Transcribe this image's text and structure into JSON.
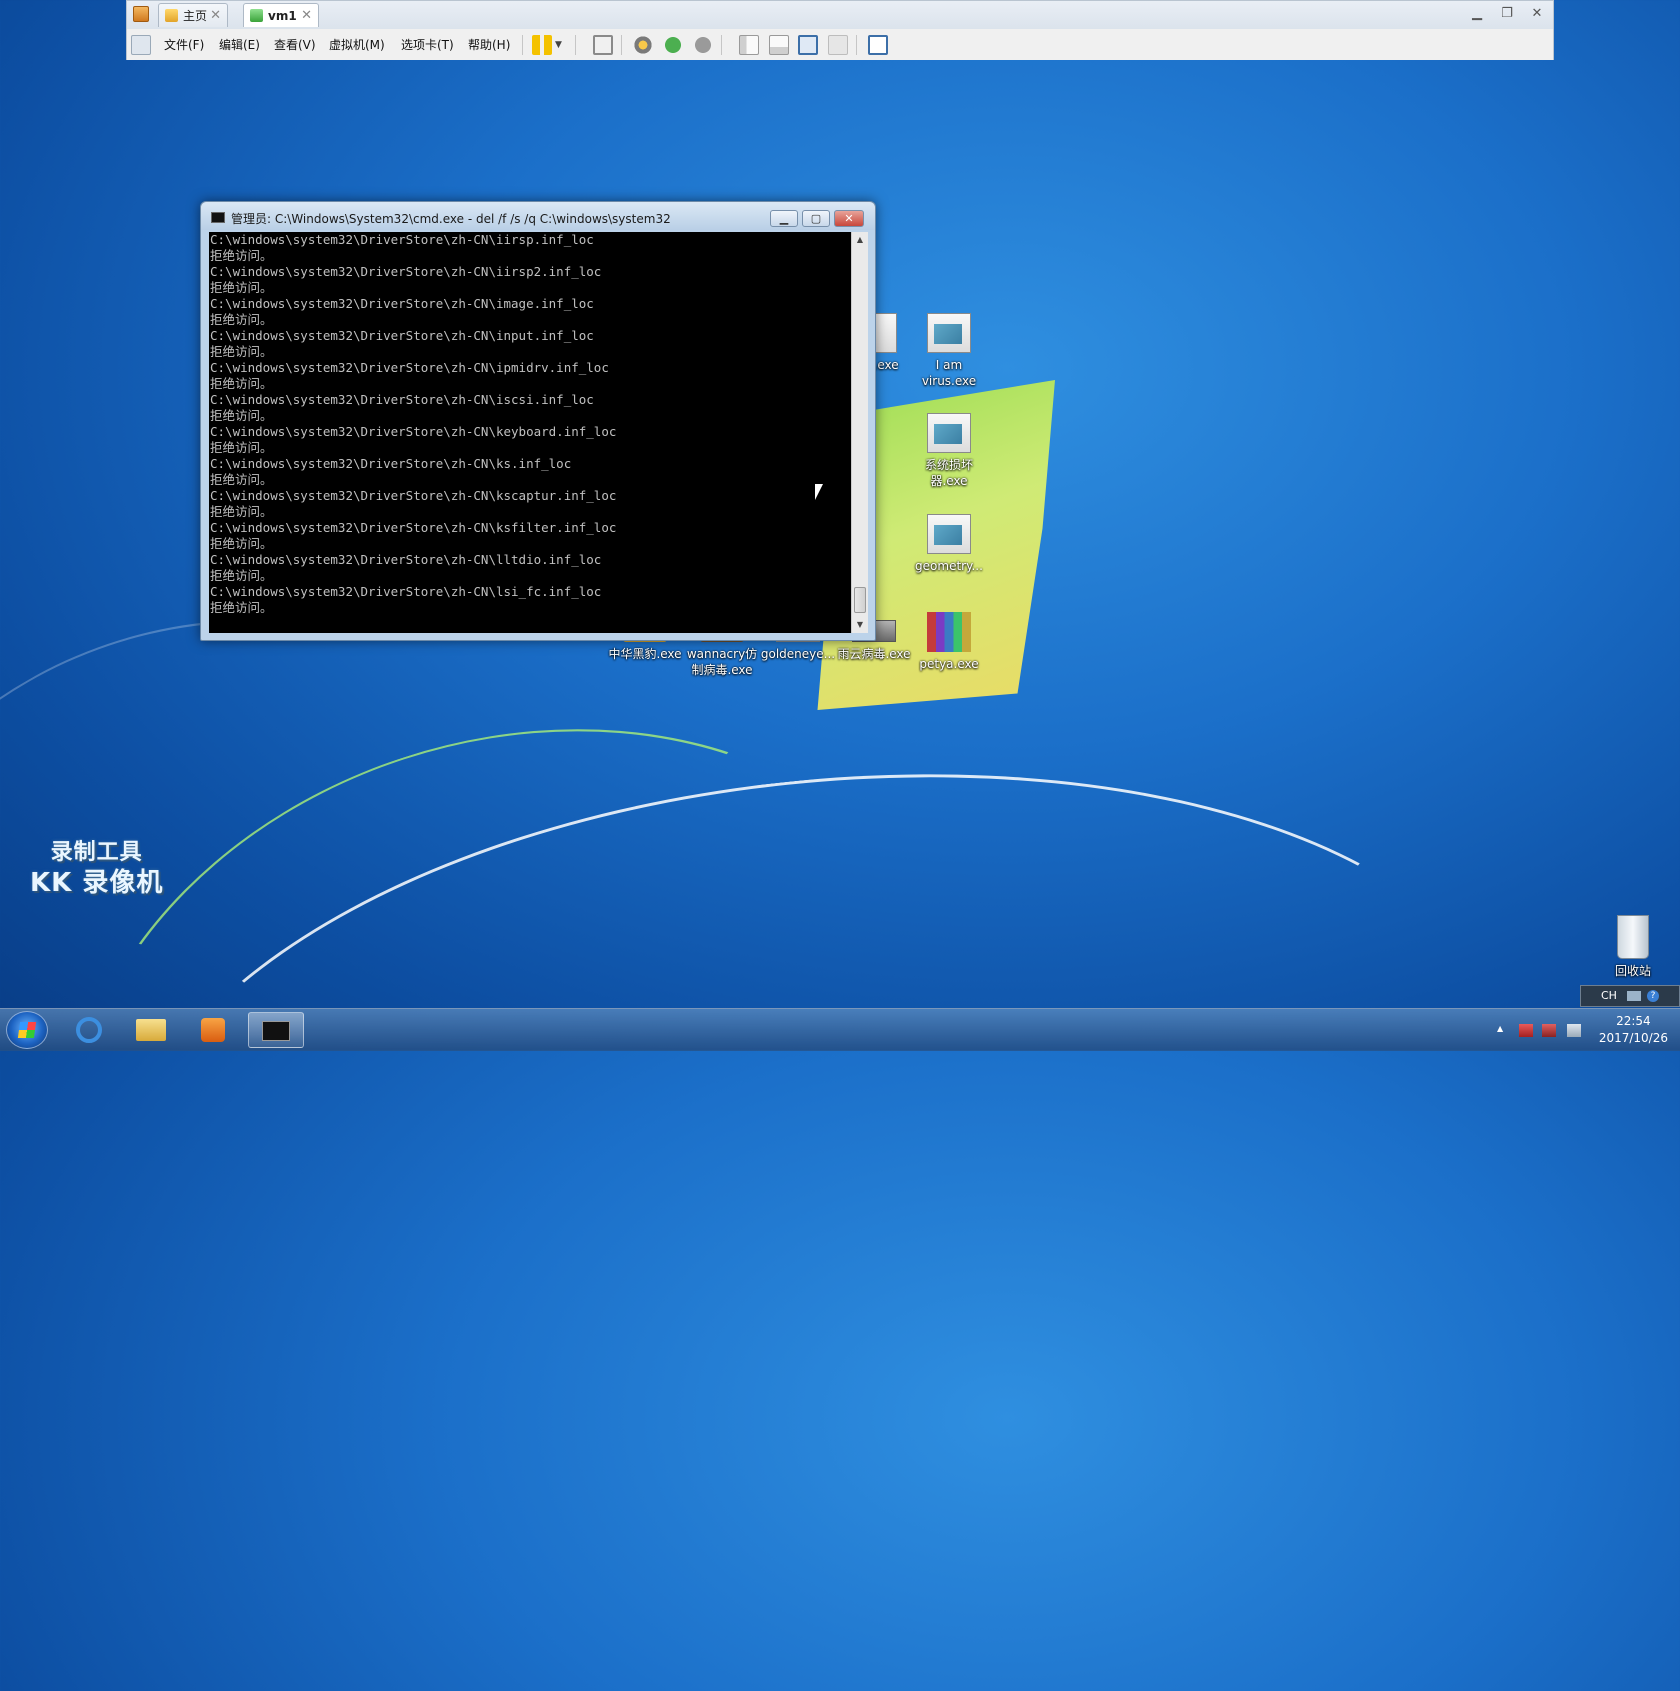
{
  "vm": {
    "tabs": [
      {
        "label": "主页",
        "active": false
      },
      {
        "label": "vm1",
        "active": true
      }
    ],
    "menu": [
      "文件(F)",
      "编辑(E)",
      "查看(V)",
      "虚拟机(M)",
      "选项卡(T)",
      "帮助(H)"
    ]
  },
  "cmd": {
    "title": "管理员: C:\\Windows\\System32\\cmd.exe - del  /f /s /q C:\\windows\\system32",
    "lines": [
      "C:\\windows\\system32\\DriverStore\\zh-CN\\iirsp.inf_loc",
      "拒绝访问。",
      "C:\\windows\\system32\\DriverStore\\zh-CN\\iirsp2.inf_loc",
      "拒绝访问。",
      "C:\\windows\\system32\\DriverStore\\zh-CN\\image.inf_loc",
      "拒绝访问。",
      "C:\\windows\\system32\\DriverStore\\zh-CN\\input.inf_loc",
      "拒绝访问。",
      "C:\\windows\\system32\\DriverStore\\zh-CN\\ipmidrv.inf_loc",
      "拒绝访问。",
      "C:\\windows\\system32\\DriverStore\\zh-CN\\iscsi.inf_loc",
      "拒绝访问。",
      "C:\\windows\\system32\\DriverStore\\zh-CN\\keyboard.inf_loc",
      "拒绝访问。",
      "C:\\windows\\system32\\DriverStore\\zh-CN\\ks.inf_loc",
      "拒绝访问。",
      "C:\\windows\\system32\\DriverStore\\zh-CN\\kscaptur.inf_loc",
      "拒绝访问。",
      "C:\\windows\\system32\\DriverStore\\zh-CN\\ksfilter.inf_loc",
      "拒绝访问。",
      "C:\\windows\\system32\\DriverStore\\zh-CN\\lltdio.inf_loc",
      "拒绝访问。",
      "C:\\windows\\system32\\DriverStore\\zh-CN\\lsi_fc.inf_loc",
      "拒绝访问。"
    ]
  },
  "desktop": {
    "icons": {
      "z_exe": "Z.exe",
      "i_am_virus": "I am virus.exe",
      "system_destroyer": "系统损坏器.exe",
      "geometry": "geometry...",
      "zhonghua": "中华黑豹.exe",
      "wannacry": "wannacry仿制病毒.exe",
      "goldeneye": "goldeneye...",
      "rain": "雨云病毒.exe",
      "petya": "petya.exe",
      "recycle_bin": "回收站"
    },
    "watermark": {
      "line1": "录制工具",
      "line2": "KK 录像机"
    }
  },
  "taskbar": {
    "lang": "CH",
    "time": "22:54",
    "date": "2017/10/26"
  }
}
